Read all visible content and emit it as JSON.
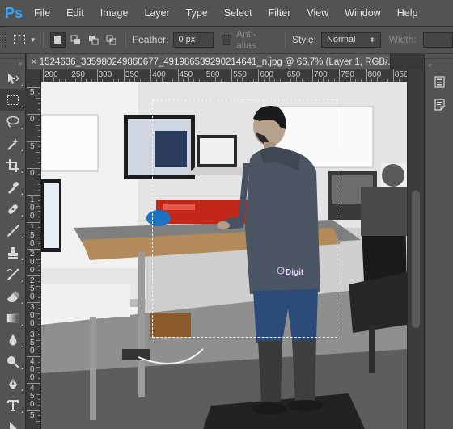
{
  "app": {
    "logo": "Ps",
    "accent": "#31a8ff"
  },
  "menu": [
    "File",
    "Edit",
    "Image",
    "Layer",
    "Type",
    "Select",
    "Filter",
    "View",
    "Window",
    "Help"
  ],
  "options": {
    "feather_label": "Feather:",
    "feather_value": "0 px",
    "antialias_label": "Anti-alias",
    "style_label": "Style:",
    "style_value": "Normal",
    "width_label": "Width:"
  },
  "document": {
    "tab_title": "1524636_335980249860677_491986539290214641_n.jpg @ 66,7% (Layer 1, RGB/..."
  },
  "ruler_h": [
    "200",
    "250",
    "300",
    "350",
    "400",
    "450",
    "500",
    "550",
    "600",
    "650",
    "700",
    "750",
    "800",
    "850"
  ],
  "ruler_v": [
    "5",
    "0",
    "5",
    "0",
    "1\n0\n0",
    "1\n5\n0",
    "2\n0\n0",
    "2\n5\n0",
    "3\n0\n0",
    "3\n5\n0",
    "4\n0\n0",
    "4\n5\n0",
    "5"
  ],
  "tools": [
    "move-tool",
    "rectangular-marquee-tool",
    "lasso-tool",
    "magic-wand-tool",
    "crop-tool",
    "eyedropper-tool",
    "spot-healing-brush-tool",
    "brush-tool",
    "clone-stamp-tool",
    "history-brush-tool",
    "eraser-tool",
    "gradient-tool",
    "blur-tool",
    "dodge-tool",
    "pen-tool",
    "type-tool",
    "path-selection-tool"
  ],
  "dock": [
    "properties-panel-icon",
    "notes-panel-icon"
  ]
}
